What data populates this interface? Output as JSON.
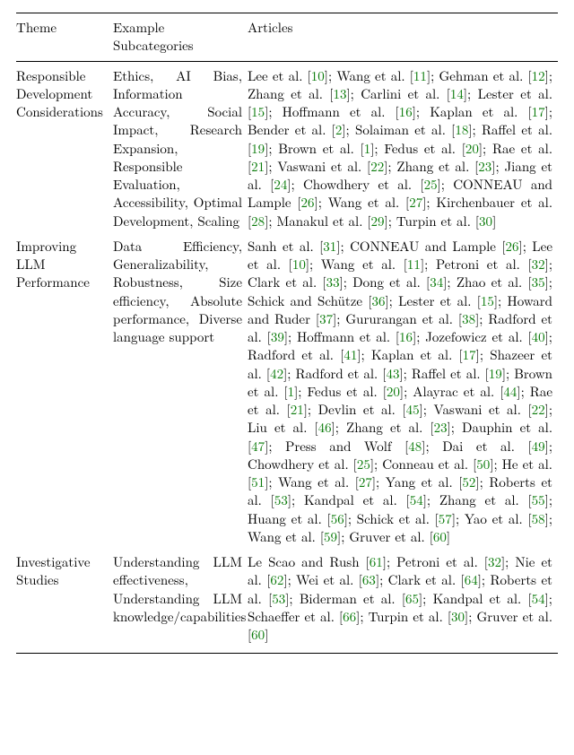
{
  "headers": {
    "theme": "Theme",
    "subcats": "Example Subcategories",
    "articles": "Articles"
  },
  "rows": [
    {
      "theme": "Responsible Development Considerations",
      "subcats": "Ethics, AI Bias, Information Accuracy, Social Impact, Research Expansion, Responsible Evaluation, Accessibility, Optimal Development, Scaling",
      "articles": [
        {
          "t": "Lee et al. [",
          "r": "10"
        },
        {
          "t": "]; Wang et al. [",
          "r": "11"
        },
        {
          "t": "]; Gehman et al. [",
          "r": "12"
        },
        {
          "t": "]; Zhang et al. [",
          "r": "13"
        },
        {
          "t": "]; Carlini et al. [",
          "r": "14"
        },
        {
          "t": "]; Lester et al. [",
          "r": "15"
        },
        {
          "t": "]; Hoffmann et al. [",
          "r": "16"
        },
        {
          "t": "]; Kaplan et al. [",
          "r": "17"
        },
        {
          "t": "]; Bender et al. [",
          "r": "2"
        },
        {
          "t": "]; Solaiman et al. [",
          "r": "18"
        },
        {
          "t": "]; Raffel et al. [",
          "r": "19"
        },
        {
          "t": "]; Brown et al. [",
          "r": "1"
        },
        {
          "t": "]; Fedus et al. [",
          "r": "20"
        },
        {
          "t": "]; Rae et al. [",
          "r": "21"
        },
        {
          "t": "]; Vaswani et al. [",
          "r": "22"
        },
        {
          "t": "]; Zhang et al. [",
          "r": "23"
        },
        {
          "t": "]; Jiang et al. [",
          "r": "24"
        },
        {
          "t": "]; Chowdhery et al. [",
          "r": "25"
        },
        {
          "t": "]; CONNEAU and Lample [",
          "r": "26"
        },
        {
          "t": "]; Wang et al. [",
          "r": "27"
        },
        {
          "t": "]; Kirchenbauer et al. [",
          "r": "28"
        },
        {
          "t": "]; Manakul et al. [",
          "r": "29"
        },
        {
          "t": "]; Turpin et al. [",
          "r": "30"
        },
        {
          "t": "]"
        }
      ]
    },
    {
      "theme": "Improving LLM Performance",
      "subcats": "Data Efficiency, Generalizability, Robustness, Size efficiency, Absolute performance, Diverse language support",
      "articles": [
        {
          "t": "Sanh et al. [",
          "r": "31"
        },
        {
          "t": "]; CONNEAU and Lample [",
          "r": "26"
        },
        {
          "t": "]; Lee et al. [",
          "r": "10"
        },
        {
          "t": "]; Wang et al. [",
          "r": "11"
        },
        {
          "t": "]; Petroni et al. [",
          "r": "32"
        },
        {
          "t": "]; Clark et al. [",
          "r": "33"
        },
        {
          "t": "]; Dong et al. [",
          "r": "34"
        },
        {
          "t": "]; Zhao et al. [",
          "r": "35"
        },
        {
          "t": "]; Schick and Schütze [",
          "r": "36"
        },
        {
          "t": "]; Lester et al. [",
          "r": "15"
        },
        {
          "t": "]; Howard and Ruder [",
          "r": "37"
        },
        {
          "t": "]; Gururangan et al. [",
          "r": "38"
        },
        {
          "t": "]; Radford et al. [",
          "r": "39"
        },
        {
          "t": "]; Hoffmann et al. [",
          "r": "16"
        },
        {
          "t": "]; Jozefowicz et al. [",
          "r": "40"
        },
        {
          "t": "]; Radford et al. [",
          "r": "41"
        },
        {
          "t": "]; Kaplan et al. [",
          "r": "17"
        },
        {
          "t": "]; Shazeer et al. [",
          "r": "42"
        },
        {
          "t": "]; Radford et al. [",
          "r": "43"
        },
        {
          "t": "]; Raffel et al. [",
          "r": "19"
        },
        {
          "t": "]; Brown et al. [",
          "r": "1"
        },
        {
          "t": "]; Fedus et al. [",
          "r": "20"
        },
        {
          "t": "]; Alayrac et al. [",
          "r": "44"
        },
        {
          "t": "]; Rae et al. [",
          "r": "21"
        },
        {
          "t": "]; Devlin et al. [",
          "r": "45"
        },
        {
          "t": "]; Vaswani et al. [",
          "r": "22"
        },
        {
          "t": "]; Liu et al. [",
          "r": "46"
        },
        {
          "t": "]; Zhang et al. [",
          "r": "23"
        },
        {
          "t": "]; Dauphin et al. [",
          "r": "47"
        },
        {
          "t": "]; Press and Wolf [",
          "r": "48"
        },
        {
          "t": "]; Dai et al. [",
          "r": "49"
        },
        {
          "t": "]; Chowdhery et al. [",
          "r": "25"
        },
        {
          "t": "]; Conneau et al. [",
          "r": "50"
        },
        {
          "t": "]; He et al. [",
          "r": "51"
        },
        {
          "t": "]; Wang et al. [",
          "r": "27"
        },
        {
          "t": "]; Yang et al. [",
          "r": "52"
        },
        {
          "t": "]; Roberts et al. [",
          "r": "53"
        },
        {
          "t": "]; Kandpal et al. [",
          "r": "54"
        },
        {
          "t": "]; Zhang et al. [",
          "r": "55"
        },
        {
          "t": "]; Huang et al. [",
          "r": "56"
        },
        {
          "t": "]; Schick et al. [",
          "r": "57"
        },
        {
          "t": "]; Yao et al. [",
          "r": "58"
        },
        {
          "t": "]; Wang et al. [",
          "r": "59"
        },
        {
          "t": "]; Gruver et al. [",
          "r": "60"
        },
        {
          "t": "]"
        }
      ]
    },
    {
      "theme": "Investigative Studies",
      "subcats": "Understanding LLM effectiveness, Understanding LLM knowledge/capabilities",
      "articles": [
        {
          "t": "Le Scao and Rush [",
          "r": "61"
        },
        {
          "t": "]; Petroni et al. [",
          "r": "32"
        },
        {
          "t": "]; Nie et al. [",
          "r": "62"
        },
        {
          "t": "]; Wei et al. [",
          "r": "63"
        },
        {
          "t": "]; Clark et al. [",
          "r": "64"
        },
        {
          "t": "]; Roberts et al. [",
          "r": "53"
        },
        {
          "t": "]; Biderman et al. [",
          "r": "65"
        },
        {
          "t": "]; Kandpal et al. [",
          "r": "54"
        },
        {
          "t": "]; Schaeffer et al. [",
          "r": "66"
        },
        {
          "t": "]; Turpin et al. [",
          "r": "30"
        },
        {
          "t": "]; Gruver et al. [",
          "r": "60"
        },
        {
          "t": "]"
        }
      ]
    }
  ]
}
